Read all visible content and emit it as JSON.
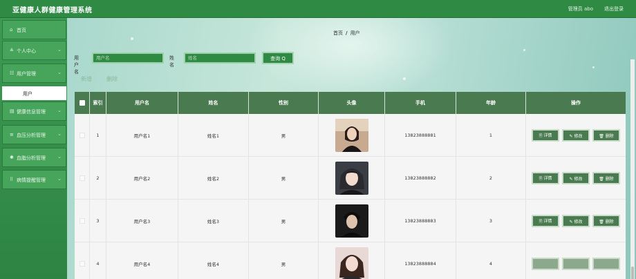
{
  "header": {
    "title": "亚健康人群健康管理系统",
    "user_label": "管理员 abo",
    "logout_label": "退出登录"
  },
  "sidebar": {
    "items": [
      {
        "icon": "home-icon",
        "glyph": "⌂",
        "label": "首页",
        "has_chevron": false
      },
      {
        "icon": "user-icon",
        "glyph": "≗",
        "label": "个人中心",
        "has_chevron": true
      },
      {
        "icon": "users-icon",
        "glyph": "☷",
        "label": "用户管理",
        "has_chevron": true
      },
      {
        "icon": "list-icon",
        "glyph": "▤",
        "label": "健康信息管理",
        "has_chevron": true
      },
      {
        "icon": "list-icon",
        "glyph": "≡",
        "label": "血压分析管理",
        "has_chevron": true
      },
      {
        "icon": "sugar-icon",
        "glyph": "✱",
        "label": "血脂分析管理",
        "has_chevron": true
      },
      {
        "icon": "grid-icon",
        "glyph": "⠿",
        "label": "病情提醒管理",
        "has_chevron": true
      }
    ],
    "submenu_label": "用户"
  },
  "breadcrumb": {
    "home": "首页",
    "separator": "/",
    "current": "用户"
  },
  "search": {
    "username_label": "用户名",
    "username_placeholder": "用户名",
    "name_label": "姓名",
    "name_placeholder": "姓名",
    "button_label": "查询 Q"
  },
  "actions": {
    "add_label": "新增",
    "delete_label": "删除"
  },
  "table": {
    "columns": [
      "",
      "索引",
      "用户名",
      "姓名",
      "性别",
      "头像",
      "手机",
      "年龄",
      "操作"
    ],
    "rows": [
      {
        "index": "1",
        "username": "用户名1",
        "name": "姓名1",
        "gender": "男",
        "phone": "13823888881",
        "age": "1"
      },
      {
        "index": "2",
        "username": "用户名2",
        "name": "姓名2",
        "gender": "男",
        "phone": "13823888882",
        "age": "2"
      },
      {
        "index": "3",
        "username": "用户名3",
        "name": "姓名3",
        "gender": "男",
        "phone": "13823888883",
        "age": "3"
      },
      {
        "index": "4",
        "username": "用户名4",
        "name": "姓名4",
        "gender": "男",
        "phone": "13823888884",
        "age": "4"
      }
    ],
    "row_buttons": {
      "detail": "🗎 详情",
      "edit": "✎ 修改",
      "delete": "🗑 删除"
    }
  },
  "colors": {
    "primary_green": "#2f8a44",
    "header_green": "#4a7a4f",
    "background_teal": "#b6ded4"
  }
}
